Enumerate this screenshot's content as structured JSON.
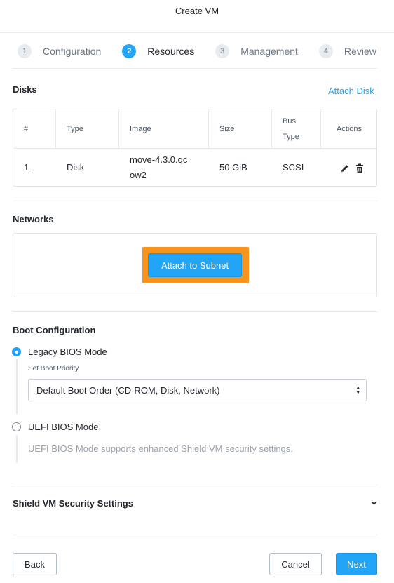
{
  "title": "Create VM",
  "steps": [
    {
      "num": "1",
      "label": "Configuration"
    },
    {
      "num": "2",
      "label": "Resources"
    },
    {
      "num": "3",
      "label": "Management"
    },
    {
      "num": "4",
      "label": "Review"
    }
  ],
  "active_step": "Resources",
  "disks": {
    "title": "Disks",
    "attach_label": "Attach Disk",
    "columns": [
      "#",
      "Type",
      "Image",
      "Size",
      "Bus Type",
      "Actions"
    ],
    "rows": [
      {
        "num": "1",
        "type": "Disk",
        "image": "move-4.3.0.qcow2",
        "size": "50 GiB",
        "bus": "SCSI",
        "actions": [
          "edit-icon",
          "delete-icon"
        ]
      }
    ]
  },
  "networks": {
    "title": "Networks",
    "attach_label": "Attach to Subnet"
  },
  "boot": {
    "title": "Boot Configuration",
    "legacy_label": "Legacy BIOS Mode",
    "priority_label": "Set Boot Priority",
    "priority_value": "Default Boot Order (CD-ROM, Disk, Network)",
    "uefi_label": "UEFI BIOS Mode",
    "uefi_note": "UEFI BIOS Mode supports enhanced Shield VM security settings.",
    "selected": "Legacy BIOS Mode"
  },
  "shield": {
    "title": "Shield VM Security Settings"
  },
  "footer": {
    "back": "Back",
    "cancel": "Cancel",
    "next": "Next"
  },
  "colors": {
    "accent": "#22a5f7",
    "highlight": "#f7941d"
  }
}
